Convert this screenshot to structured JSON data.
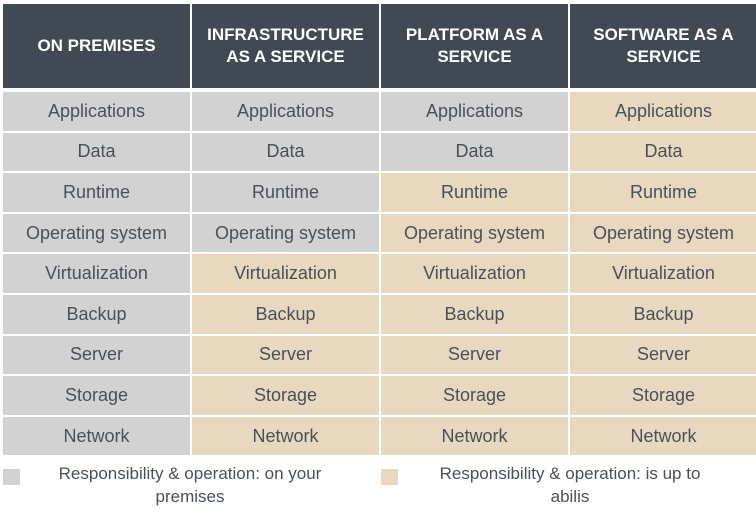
{
  "colors": {
    "header": "#414a54",
    "on_premises": "#d2d2d2",
    "provider": "#e8d8bf"
  },
  "columns": [
    {
      "title": "ON PREMISES",
      "on_premises_layers": 9
    },
    {
      "title": "INFRASTRUCTURE\nAS A SERVICE",
      "on_premises_layers": 4
    },
    {
      "title": "PLATFORM AS A\nSERVICE",
      "on_premises_layers": 2
    },
    {
      "title": "SOFTWARE AS A\nSERVICE",
      "on_premises_layers": 0
    }
  ],
  "layers": [
    "Applications",
    "Data",
    "Runtime",
    "Operating system",
    "Virtualization",
    "Backup",
    "Server",
    "Storage",
    "Network"
  ],
  "legend": [
    {
      "label": "Responsibility & operation: on your premises"
    },
    {
      "label": "Responsibility & operation: is up to abilis"
    }
  ]
}
